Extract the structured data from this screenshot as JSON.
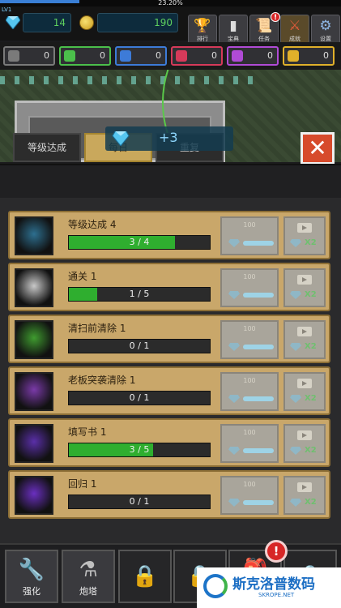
{
  "status": {
    "percent": "23.20%"
  },
  "resources": {
    "level_badge": "LV1",
    "gems": "14",
    "coins": "190"
  },
  "top_buttons": [
    {
      "label": "排行",
      "icon": "trophy-icon"
    },
    {
      "label": "宝典",
      "icon": "book-icon"
    },
    {
      "label": "任务",
      "icon": "quest-scroll-icon",
      "badge": "!"
    },
    {
      "label": "成就",
      "icon": "sword-icon"
    },
    {
      "label": "设置",
      "icon": "gear-icon"
    }
  ],
  "keys": [
    {
      "value": "0",
      "color": "#7a7a7a"
    },
    {
      "value": "0",
      "color": "#4bbf4b"
    },
    {
      "value": "0",
      "color": "#3d7bd8"
    },
    {
      "value": "0",
      "color": "#d63a5a"
    },
    {
      "value": "0",
      "color": "#b04bd6"
    },
    {
      "value": "0",
      "color": "#e0b02a"
    }
  ],
  "tabs": [
    {
      "label": "等级达成",
      "active": false
    },
    {
      "label": "每日",
      "active": true
    },
    {
      "label": "重复",
      "active": false
    }
  ],
  "toast": {
    "text": "+3"
  },
  "achievements": [
    {
      "title": "等级达成 4",
      "progress": "3 / 4",
      "ratio": 0.75,
      "thumb": "#2d6f8f",
      "claim_amount": "100",
      "multiplier": "X2"
    },
    {
      "title": "通关 1",
      "progress": "1 / 5",
      "ratio": 0.2,
      "thumb": "#c8c8c8",
      "claim_amount": "100",
      "multiplier": "X2"
    },
    {
      "title": "清扫前清除 1",
      "progress": "0 / 1",
      "ratio": 0,
      "thumb": "#3f9b2f",
      "claim_amount": "100",
      "multiplier": "X2"
    },
    {
      "title": "老板突袭清除 1",
      "progress": "0 / 1",
      "ratio": 0,
      "thumb": "#7a3aa8",
      "claim_amount": "100",
      "multiplier": "X2"
    },
    {
      "title": "填写书 1",
      "progress": "3 / 5",
      "ratio": 0.6,
      "thumb": "#5a2fa8",
      "claim_amount": "100",
      "multiplier": "X2"
    },
    {
      "title": "回归 1",
      "progress": "0 / 1",
      "ratio": 0,
      "thumb": "#6a2fc0",
      "claim_amount": "100",
      "multiplier": "X2"
    }
  ],
  "bottom_nav": [
    {
      "label": "强化",
      "icon": "wrench-icon"
    },
    {
      "label": "炮塔",
      "icon": "potion-icon"
    },
    {
      "label": "",
      "icon": "lock-icon"
    },
    {
      "label": "",
      "icon": "lock-icon"
    },
    {
      "label": "",
      "icon": "backpack-icon"
    },
    {
      "label": "",
      "icon": "lock-icon"
    }
  ],
  "notice_badge": "!",
  "watermark": {
    "title": "斯克洛普数码",
    "subtitle": "SKROPE.NET"
  }
}
